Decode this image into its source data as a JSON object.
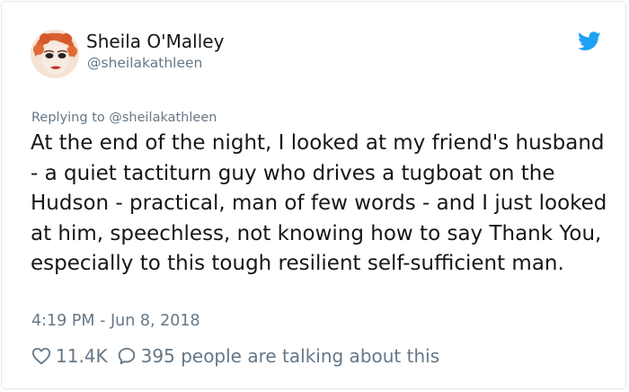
{
  "author": {
    "display_name": "Sheila O'Malley",
    "handle": "@sheilakathleen"
  },
  "reply_context": "Replying to @sheilakathleen",
  "tweet": {
    "text": "At the end of the night, I looked at my friend's husband - a quiet tactiturn guy who drives a tugboat on the Hudson - practical, man of few words - and I just looked at him, speechless, not knowing how to say Thank You, especially to this tough resilient self-sufficient man.",
    "timestamp": "4:19 PM - Jun 8, 2018"
  },
  "stats": {
    "likes": "11.4K",
    "conversation": "395 people are talking about this"
  },
  "icons": {
    "brand": "twitter-bird-icon",
    "like": "heart-icon",
    "reply": "speech-bubble-icon"
  },
  "colors": {
    "brand_blue": "#1da1f2",
    "text_primary": "#14171a",
    "text_secondary": "#657786",
    "border": "#e1e8ed"
  }
}
